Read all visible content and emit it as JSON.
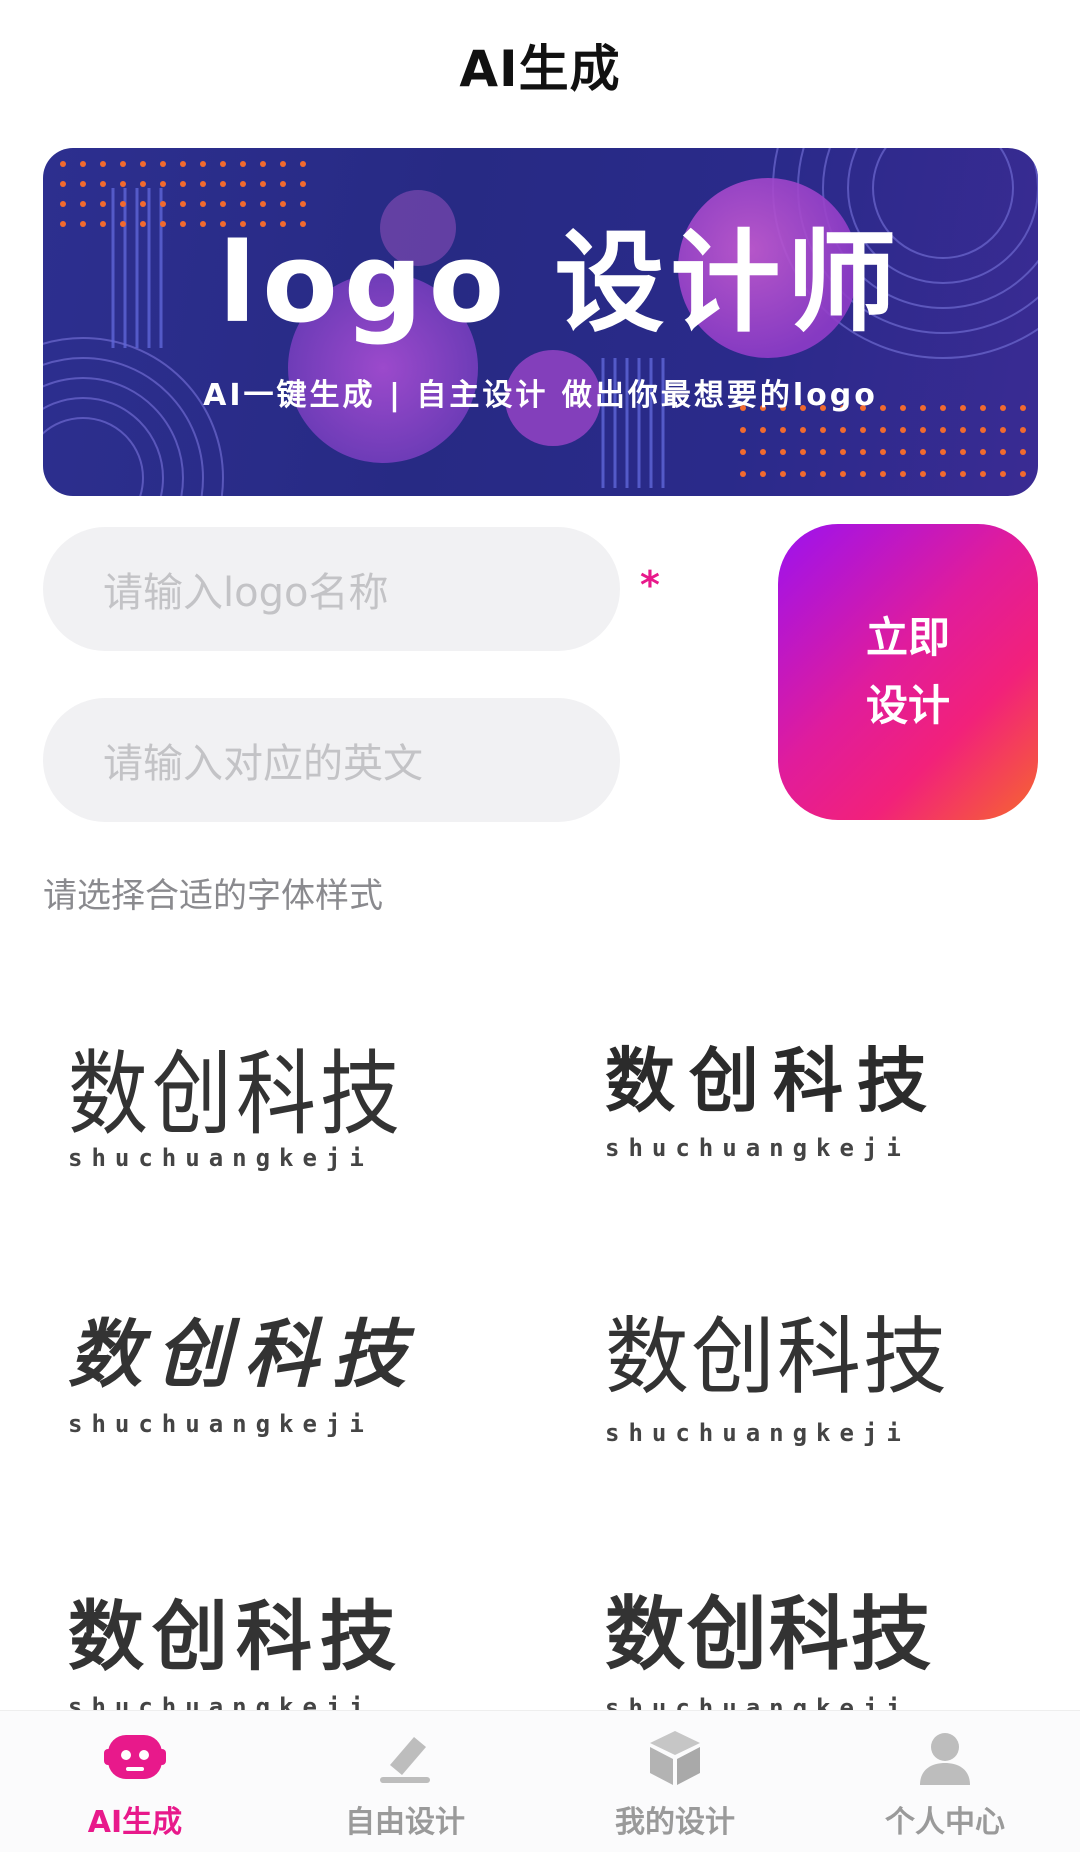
{
  "header": {
    "title": "AI生成"
  },
  "banner": {
    "title": "logo 设计师",
    "subtitle": "AI一键生成 | 自主设计   做出你最想要的logo"
  },
  "form": {
    "name_placeholder": "请输入logo名称",
    "english_placeholder": "请输入对应的英文",
    "required_mark": "*",
    "design_button_line1": "立即",
    "design_button_line2": "设计",
    "font_hint": "请选择合适的字体样式"
  },
  "font_samples": [
    {
      "zh": "数创科技",
      "en": "shuchuangkeji"
    },
    {
      "zh": "数创科技",
      "en": "shuchuangkeji"
    },
    {
      "zh": "数创科技",
      "en": "shuchuangkeji"
    },
    {
      "zh": "数创科技",
      "en": "shuchuangkeji"
    },
    {
      "zh": "数创科技",
      "en": "shuchuangkeji"
    },
    {
      "zh": "数创科技",
      "en": "shuchuangkeji"
    }
  ],
  "tabs": [
    {
      "label": "AI生成",
      "icon": "robot-icon",
      "active": true
    },
    {
      "label": "自由设计",
      "icon": "pen-icon",
      "active": false
    },
    {
      "label": "我的设计",
      "icon": "box-icon",
      "active": false
    },
    {
      "label": "个人中心",
      "icon": "user-icon",
      "active": false
    }
  ],
  "colors": {
    "accent": "#e8198b",
    "banner_bg": "#2a2b8a",
    "button_gradient_start": "#9b12f0",
    "button_gradient_end": "#f6672e",
    "input_bg": "#f1f1f3"
  }
}
